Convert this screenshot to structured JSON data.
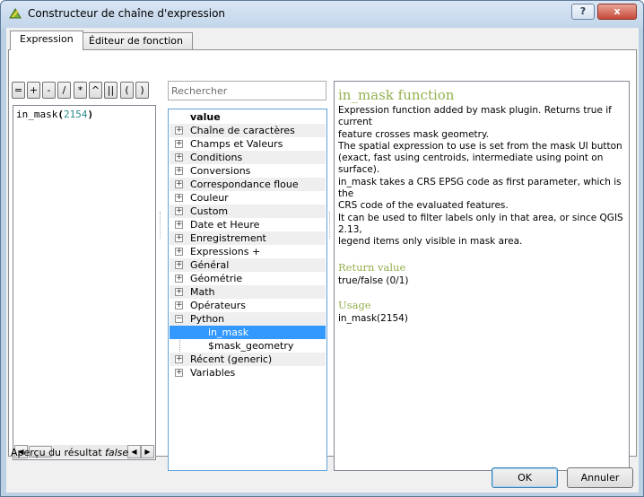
{
  "window": {
    "title": "Constructeur de chaîne d'expression",
    "help_label": "?",
    "close_label": "x"
  },
  "tabs": [
    {
      "label": "Expression",
      "active": true
    },
    {
      "label": "Éditeur de fonction",
      "active": false
    }
  ],
  "operators": [
    "=",
    "+",
    "-",
    "/",
    "*",
    "^",
    "||",
    "(",
    ")"
  ],
  "editor": {
    "func_name": "in_mask",
    "open_paren": "(",
    "argument": "2154",
    "close_paren": ")"
  },
  "search": {
    "placeholder": "Rechercher",
    "value": ""
  },
  "tree": {
    "items": [
      {
        "label": "value",
        "expander": "",
        "bold": true,
        "child": false
      },
      {
        "label": "Chaîne de caractères",
        "expander": "+"
      },
      {
        "label": "Champs et Valeurs",
        "expander": "+"
      },
      {
        "label": "Conditions",
        "expander": "+"
      },
      {
        "label": "Conversions",
        "expander": "+"
      },
      {
        "label": "Correspondance floue",
        "expander": "+"
      },
      {
        "label": "Couleur",
        "expander": "+"
      },
      {
        "label": "Custom",
        "expander": "+"
      },
      {
        "label": "Date et Heure",
        "expander": "+"
      },
      {
        "label": "Enregistrement",
        "expander": "+"
      },
      {
        "label": "Expressions +",
        "expander": "+"
      },
      {
        "label": "Général",
        "expander": "+"
      },
      {
        "label": "Géométrie",
        "expander": "+"
      },
      {
        "label": "Math",
        "expander": "+"
      },
      {
        "label": "Opérateurs",
        "expander": "+"
      },
      {
        "label": "Python",
        "expander": "−"
      },
      {
        "label": "in_mask",
        "expander": "",
        "child": true,
        "selected": true
      },
      {
        "label": "$mask_geometry",
        "expander": "",
        "child": true
      },
      {
        "label": "Récent (generic)",
        "expander": "+"
      },
      {
        "label": "Variables",
        "expander": "+"
      }
    ]
  },
  "help": {
    "title": "in_mask function",
    "description": [
      "Expression function added by mask plugin. Returns true if current",
      "feature crosses mask geometry.",
      "The spatial expression to use is set from the mask UI button",
      "(exact, fast using centroids, intermediate using point on surface).",
      "in_mask takes a CRS EPSG code as first parameter, which is the",
      "CRS code of the evaluated features.",
      "It can be used to filter labels only in that area, or since QGIS 2.13,",
      "legend items only visible in mask area."
    ],
    "return_heading": "Return value",
    "return_value": "true/false (0/1)",
    "usage_heading": "Usage",
    "usage_value": "in_mask(2154)"
  },
  "preview": {
    "label": "Aperçu du résultat :",
    "value": "false"
  },
  "buttons": {
    "ok": "OK",
    "cancel": "Annuler"
  },
  "colors": {
    "help_heading": "#93b04f",
    "selection": "#3399ff",
    "argument_number": "#2a8a8a"
  }
}
